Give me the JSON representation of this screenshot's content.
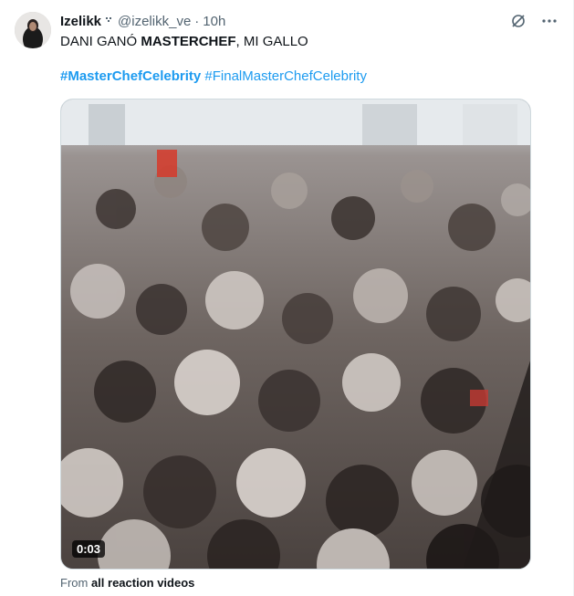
{
  "tweet": {
    "display_name": "Izelikk",
    "handle": "@izelikk_ve",
    "separator": "·",
    "time": "10h",
    "text_part1": "DANI GANÓ ",
    "text_bold": "MASTERCHEF",
    "text_part2": ", MI GALLO",
    "hashtag1": "#MasterChefCelebrity",
    "hashtag2": "#FinalMasterChefCelebrity"
  },
  "media": {
    "duration": "0:03"
  },
  "source": {
    "prefix": "From ",
    "link": "all reaction videos"
  },
  "colors": {
    "link": "#1d9bf0",
    "secondary_text": "#536471",
    "primary_text": "#0f1419"
  },
  "icons": {
    "grok": "grok-icon",
    "more": "more-icon",
    "verified": "verified-badge-icon"
  }
}
